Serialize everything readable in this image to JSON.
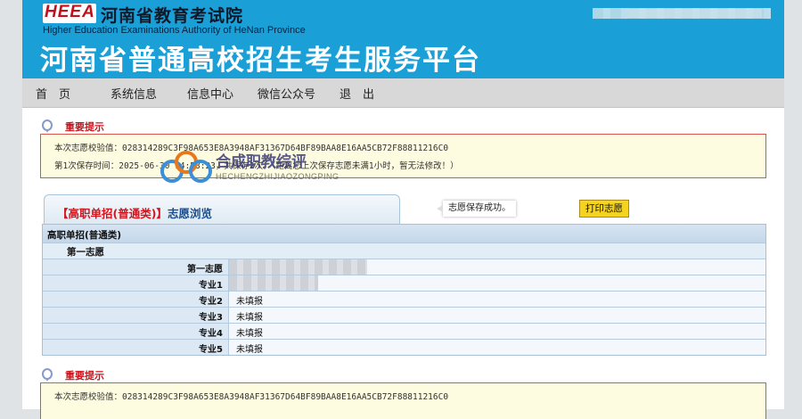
{
  "header": {
    "logo_text": "HEEA",
    "org_name_cn": "河南省教育考试院",
    "org_name_en": "Higher Education Examinations Authority of HeNan Province",
    "platform_title": "河南省普通高校招生考生服务平台"
  },
  "nav": [
    "首　页",
    "系统信息",
    "信息中心",
    "微信公众号",
    "退　出"
  ],
  "notice1": {
    "title": "重要提示",
    "line1": "本次志愿校验值：028314289C3F98A653E8A3948AF31367D64BF89BAA8E16AA5CB72F88811216C0",
    "line2": "第1次保存时间：2025-06-30 14:58:23，共保存2次。（距离您上次保存志愿未满1小时，暂无法修改！）"
  },
  "watermark": {
    "cn": "合成职教综评",
    "en": "HECHENGZHIJIAOZONGPING"
  },
  "panel": {
    "tab_prefix": "【高职单招(普通类)】",
    "tab_suffix": "志愿浏览",
    "toast": "志愿保存成功。",
    "print_button": "打印志愿"
  },
  "table": {
    "group": "高职单招(普通类)",
    "subgroup": "第一志愿",
    "rows": [
      {
        "label": "第一志愿",
        "value": ""
      },
      {
        "label": "专业1",
        "value": ""
      },
      {
        "label": "专业2",
        "value": "未填报"
      },
      {
        "label": "专业3",
        "value": "未填报"
      },
      {
        "label": "专业4",
        "value": "未填报"
      },
      {
        "label": "专业5",
        "value": "未填报"
      }
    ]
  },
  "notice2": {
    "title": "重要提示",
    "line1": "本次志愿校验值：028314289C3F98A653E8A3948AF31367D64BF89BAA8E16AA5CB72F88811216C0"
  },
  "colors": {
    "header_bg": "#1a9fd6",
    "notice_title": "#c8151d",
    "print_button_bg": "#f6d31f"
  }
}
